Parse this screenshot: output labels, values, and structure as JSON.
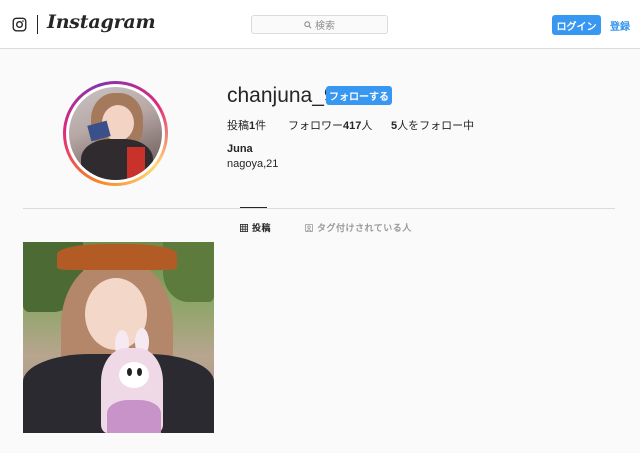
{
  "header": {
    "wordmark": "Instagram",
    "search_placeholder": "検索",
    "login_label": "ログイン",
    "signup_label": "登録",
    "icons": {
      "logo": "instagram-camera-icon",
      "search": "search-icon"
    }
  },
  "profile": {
    "username": "chanjuna_9",
    "follow_label": "フォローする",
    "stats": {
      "posts_label": "投稿",
      "posts_count": "1",
      "posts_unit": "件",
      "followers_label": "フォロワー",
      "followers_count": "417",
      "followers_unit": "人",
      "following_count": "5",
      "following_label": "人をフォロー中"
    },
    "full_name": "Juna",
    "bio": "nagoya,21"
  },
  "tabs": [
    {
      "label": "投稿",
      "icon": "grid-icon",
      "active": true
    },
    {
      "label": "タグ付けされている人",
      "icon": "tagged-icon",
      "active": false
    }
  ],
  "colors": {
    "accent": "#3897f0",
    "text": "#262626",
    "border": "#dbdbdb",
    "background": "#fafafa"
  }
}
